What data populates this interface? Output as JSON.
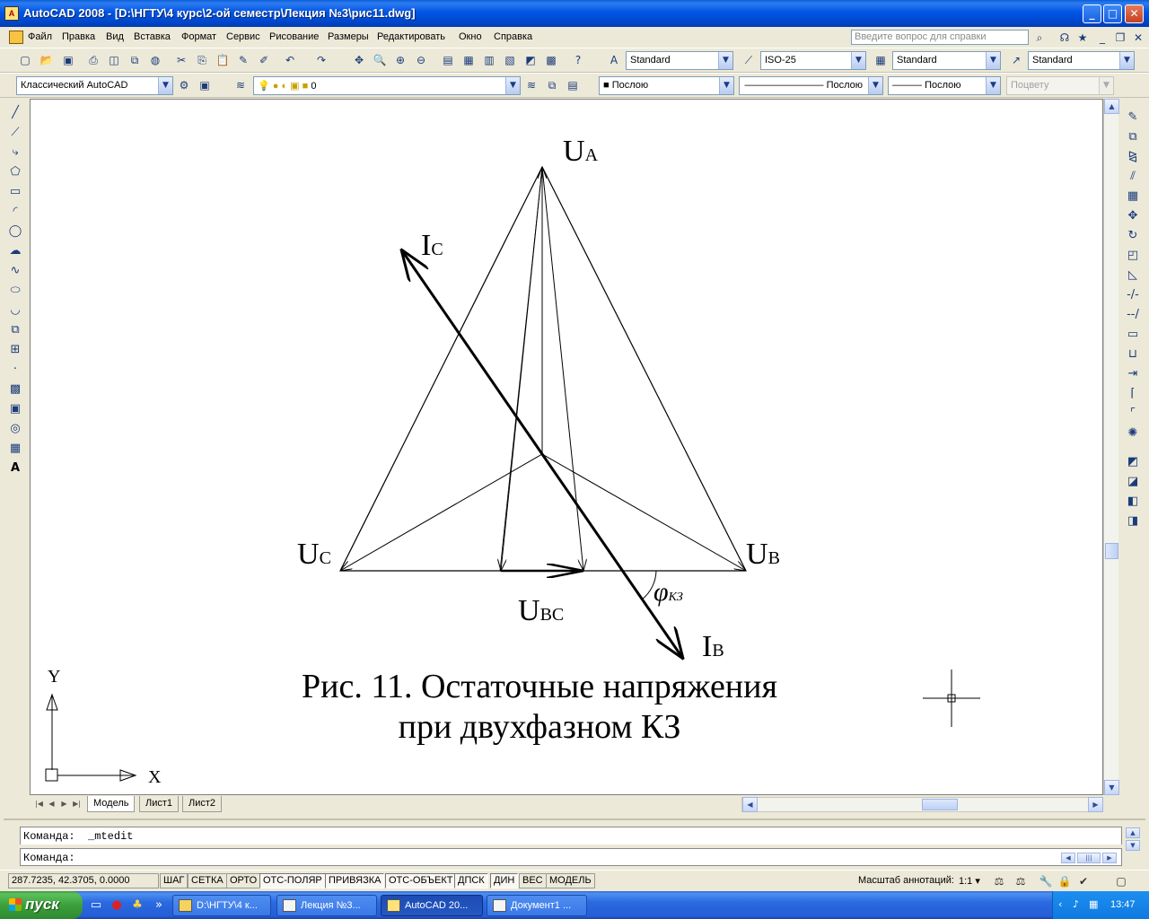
{
  "window": {
    "title": "AutoCAD 2008 - [D:\\НГТУ\\4 курс\\2-ой семестр\\Лекция №3\\рис11.dwg]",
    "buttons": {
      "minimize": "_",
      "maximize": "□",
      "close": "✕"
    }
  },
  "menu": {
    "items": [
      "Файл",
      "Правка",
      "Вид",
      "Вставка",
      "Формат",
      "Сервис",
      "Рисование",
      "Размеры",
      "Редактировать",
      "Окно",
      "Справка"
    ],
    "help_placeholder": "Введите вопрос для справки"
  },
  "styles_toolbar": {
    "text_style": "Standard",
    "dim_style": "ISO-25",
    "table_style": "Standard",
    "mleader_style": "Standard"
  },
  "layers_toolbar": {
    "workspace": "Классический AutoCAD",
    "layer": "0",
    "color": "Послою",
    "linetype": "Послою",
    "lineweight": "Послою",
    "plotstyle": "Поцвету"
  },
  "drawing": {
    "labels": {
      "ua_main": "U",
      "ua_sub": "A",
      "ic_main": "I",
      "ic_sub": "C",
      "uc_main": "U",
      "uc_sub": "C",
      "ub_main": "U",
      "ub_sub": "B",
      "ubc_main": "U",
      "ubc_sub": "BC",
      "ib_main": "I",
      "ib_sub": "B",
      "phi_main": "φ",
      "phi_sub": "КЗ"
    },
    "caption_line1": "Рис. 11. Остаточные напряжения",
    "caption_line2": "при двухфазном КЗ",
    "ucs": {
      "y": "Y",
      "x": "X"
    }
  },
  "layout_tabs": [
    "Модель",
    "Лист1",
    "Лист2"
  ],
  "command": {
    "history": "Команда:  _mtedit",
    "prompt": "Команда:"
  },
  "status": {
    "coordinates": "287.7235, 42.3705, 0.0000",
    "toggles": [
      "ШАГ",
      "СЕТКА",
      "ОРТО",
      "ОТС-ПОЛЯР",
      "ПРИВЯЗКА",
      "ОТС-ОБЪЕКТ",
      "ДПСК",
      "ДИН",
      "ВЕС",
      "МОДЕЛЬ"
    ],
    "annotation_scale_label": "Масштаб аннотаций:",
    "annotation_scale_value": "1:1 ▾"
  },
  "taskbar": {
    "start": "пуск",
    "tasks": [
      "D:\\НГТУ\\4 к...",
      "Лекция №3...",
      "AutoCAD 20...",
      "Документ1 ..."
    ],
    "active_task": 2,
    "clock": "13:47"
  }
}
